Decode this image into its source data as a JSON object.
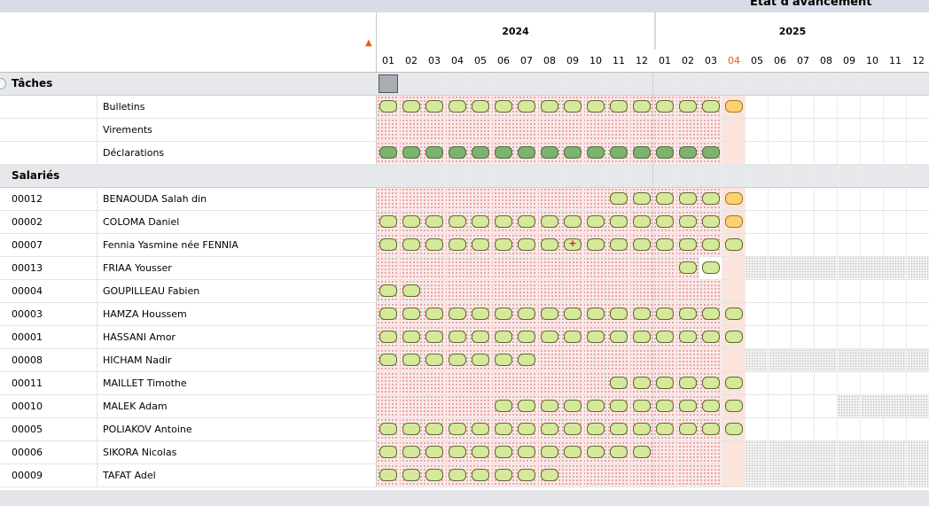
{
  "header": {
    "title": "Etat d'avancement"
  },
  "years": [
    {
      "label": "2024"
    },
    {
      "label": "2025"
    }
  ],
  "months": [
    "01",
    "02",
    "03",
    "04",
    "05",
    "06",
    "07",
    "08",
    "09",
    "10",
    "11",
    "12",
    "01",
    "02",
    "03",
    "04",
    "05",
    "06",
    "07",
    "08",
    "09",
    "10",
    "11",
    "12"
  ],
  "current_month_index": 15,
  "colors": {
    "pill_done": "#d6e89a",
    "pill_dark": "#7cb36e",
    "pill_current": "#ffd070",
    "current_month": "#e85a1a"
  },
  "rows": [
    {
      "type": "section",
      "c1": "Tâches",
      "radio": true,
      "selbox": true
    },
    {
      "type": "task",
      "c1": "",
      "c2": "Bulletins",
      "pink": [
        0,
        15
      ],
      "today": true,
      "pills": [
        [
          0,
          14,
          "ok"
        ],
        [
          15,
          15,
          "cur"
        ]
      ]
    },
    {
      "type": "task",
      "c1": "",
      "c2": "Virements",
      "pink": [
        0,
        15
      ],
      "today": true,
      "pills": []
    },
    {
      "type": "task",
      "c1": "",
      "c2": "Déclarations",
      "pink": [
        0,
        15
      ],
      "today": true,
      "pills": [
        [
          0,
          14,
          "dark"
        ]
      ]
    },
    {
      "type": "section",
      "c1": "Salariés"
    },
    {
      "type": "emp",
      "c1": "00012",
      "c2": "BENAOUDA Salah din",
      "pink": [
        0,
        15
      ],
      "today": true,
      "pills": [
        [
          10,
          14,
          "ok"
        ],
        [
          15,
          15,
          "cur"
        ]
      ]
    },
    {
      "type": "emp",
      "c1": "00002",
      "c2": "COLOMA Daniel",
      "pink": [
        0,
        15
      ],
      "today": true,
      "pills": [
        [
          0,
          14,
          "ok"
        ],
        [
          15,
          15,
          "cur"
        ]
      ]
    },
    {
      "type": "emp",
      "c1": "00007",
      "c2": "Fennia Yasmine née FENNIA",
      "pink": [
        0,
        15
      ],
      "today": true,
      "pills": [
        [
          0,
          15,
          "ok"
        ]
      ],
      "plus": 8
    },
    {
      "type": "emp",
      "c1": "00013",
      "c2": "FRIAA Yousser",
      "pink": [
        0,
        14
      ],
      "today": true,
      "gray": [
        16,
        23
      ],
      "pills": [
        [
          13,
          14,
          "ok"
        ]
      ]
    },
    {
      "type": "emp",
      "c1": "00004",
      "c2": "GOUPILLEAU Fabien",
      "pink": [
        0,
        15
      ],
      "today": true,
      "pills": [
        [
          0,
          1,
          "ok"
        ]
      ]
    },
    {
      "type": "emp",
      "c1": "00003",
      "c2": "HAMZA Houssem",
      "pink": [
        0,
        15
      ],
      "today": true,
      "pills": [
        [
          0,
          15,
          "ok"
        ]
      ]
    },
    {
      "type": "emp",
      "c1": "00001",
      "c2": "HASSANI Amor",
      "pink": [
        0,
        15
      ],
      "today": true,
      "pills": [
        [
          0,
          15,
          "ok"
        ]
      ]
    },
    {
      "type": "emp",
      "c1": "00008",
      "c2": "HICHAM Nadir",
      "pink": [
        0,
        15
      ],
      "today": true,
      "gray": [
        16,
        23
      ],
      "pills": [
        [
          0,
          6,
          "ok"
        ]
      ]
    },
    {
      "type": "emp",
      "c1": "00011",
      "c2": "MAILLET Timothe",
      "pink": [
        0,
        15
      ],
      "today": true,
      "pills": [
        [
          10,
          15,
          "ok"
        ]
      ]
    },
    {
      "type": "emp",
      "c1": "00010",
      "c2": "MALEK Adam",
      "pink": [
        0,
        15
      ],
      "today": true,
      "gray": [
        20,
        23
      ],
      "pills": [
        [
          5,
          15,
          "ok"
        ]
      ]
    },
    {
      "type": "emp",
      "c1": "00005",
      "c2": "POLIAKOV Antoine",
      "pink": [
        0,
        15
      ],
      "today": true,
      "pills": [
        [
          0,
          15,
          "ok"
        ]
      ]
    },
    {
      "type": "emp",
      "c1": "00006",
      "c2": "SIKORA Nicolas",
      "pink": [
        0,
        15
      ],
      "today": true,
      "gray": [
        16,
        23
      ],
      "pills": [
        [
          0,
          11,
          "ok"
        ]
      ]
    },
    {
      "type": "emp",
      "c1": "00009",
      "c2": "TAFAT Adel",
      "pink": [
        0,
        15
      ],
      "today": true,
      "gray": [
        16,
        23
      ],
      "pills": [
        [
          0,
          7,
          "ok"
        ]
      ]
    }
  ]
}
